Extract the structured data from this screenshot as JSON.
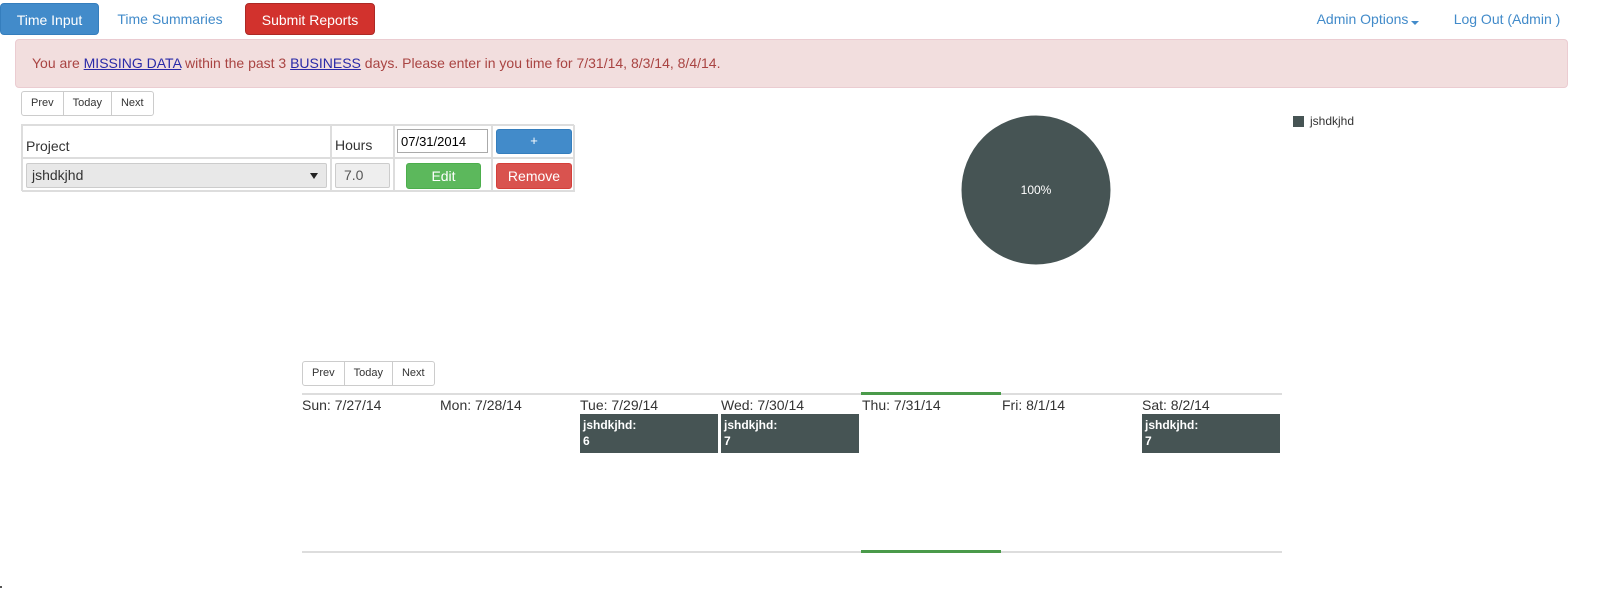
{
  "nav": {
    "time_input": "Time Input",
    "time_summaries": "Time Summaries",
    "submit_reports": "Submit Reports",
    "admin_options": "Admin Options",
    "log_out": "Log Out (Admin )"
  },
  "alert": {
    "prefix": "You are ",
    "link1": "MISSING DATA",
    "middle": " within the past 3 ",
    "link2": "BUSINESS",
    "suffix": " days. Please enter in you time for 7/31/14, 8/3/14, 8/4/14."
  },
  "pager_top": {
    "prev": "Prev",
    "today": "Today",
    "next": "Next"
  },
  "entry_table": {
    "col_project": "Project",
    "col_hours": "Hours",
    "date_value": "07/31/2014",
    "add_label": "+",
    "row": {
      "project": "jshdkjhd",
      "hours": "7.0",
      "edit_label": "Edit",
      "remove_label": "Remove"
    }
  },
  "chart_data": {
    "type": "pie",
    "slices": [
      {
        "label": "jshdkjhd",
        "value": 100,
        "display": "100%",
        "color": "#465454"
      }
    ],
    "legend": [
      "jshdkjhd"
    ],
    "legend_position": "top-right"
  },
  "pager_calendar": {
    "prev": "Prev",
    "today": "Today",
    "next": "Next"
  },
  "calendar": {
    "days": [
      {
        "label": "Sun: 7/27/14"
      },
      {
        "label": "Mon: 7/28/14"
      },
      {
        "label": "Tue: 7/29/14",
        "event": {
          "project": "jshdkjhd:",
          "hours": "6"
        }
      },
      {
        "label": "Wed: 7/30/14",
        "event": {
          "project": "jshdkjhd:",
          "hours": "7"
        }
      },
      {
        "label": "Thu: 7/31/14",
        "today": true
      },
      {
        "label": "Fri: 8/1/14"
      },
      {
        "label": "Sat: 8/2/14",
        "event": {
          "project": "jshdkjhd:",
          "hours": "7"
        }
      }
    ]
  },
  "colors": {
    "primary": "#428bca",
    "danger": "#d2322d",
    "success": "#5cb85c",
    "event": "#465454",
    "today_marker": "#4a9a4a",
    "alert_bg": "#f2dede"
  }
}
